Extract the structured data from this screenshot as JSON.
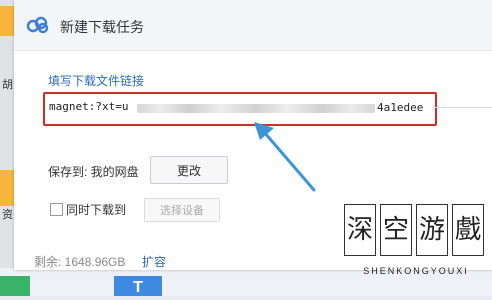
{
  "dialog": {
    "title": "新建下载任务",
    "link_label": "填写下载文件链接",
    "url_prefix": "magnet:?xt=u",
    "url_suffix": "4a1edee",
    "save_label": "保存到: 我的网盘",
    "change_button": "更改",
    "sync_download_label": "同时下载到",
    "select_device_button": "选择设备",
    "remaining": "剩余: 1648.96GB",
    "expand_link": "扩容"
  },
  "background": {
    "left_text_1": "胡",
    "left_text_2": "资",
    "bottom_tile_glyph": "T"
  },
  "watermark": {
    "chars": [
      "深",
      "空",
      "游",
      "戲"
    ],
    "text": "SHENKONGYOUXI"
  },
  "colors": {
    "highlight_border": "#d32a2a",
    "link_blue": "#2e6ab2",
    "arrow_blue": "#3d95d6"
  }
}
